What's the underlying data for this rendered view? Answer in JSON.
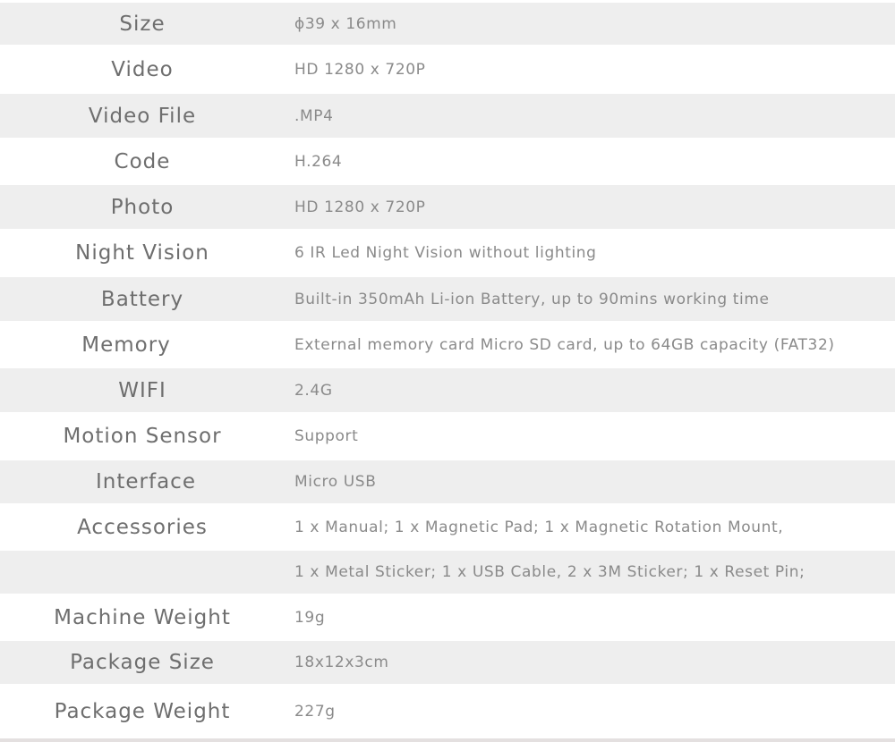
{
  "specs": [
    {
      "label": "Size",
      "value": "ϕ39 x 16mm"
    },
    {
      "label": "Video",
      "value": "HD 1280 x 720P"
    },
    {
      "label": "Video File",
      "value": ".MP4"
    },
    {
      "label": "Code",
      "value": "H.264"
    },
    {
      "label": "Photo",
      "value": "HD 1280 x 720P"
    },
    {
      "label": "Night Vision",
      "value": "6 IR Led Night Vision without lighting"
    },
    {
      "label": "Battery",
      "value": "Built-in 350mAh Li-ion Battery, up to 90mins working time"
    },
    {
      "label": "Memory",
      "value": "External memory card Micro SD card, up to 64GB capacity (FAT32)"
    },
    {
      "label": "WIFI",
      "value": "2.4G"
    },
    {
      "label": "Motion Sensor",
      "value": "Support"
    },
    {
      "label": "Interface",
      "value": "Micro USB"
    },
    {
      "label": "Accessories",
      "value": "1 x Manual; 1 x Magnetic Pad; 1 x Magnetic Rotation Mount,"
    },
    {
      "label": "",
      "value": "1 x Metal Sticker; 1 x USB Cable, 2 x 3M Sticker; 1 x Reset Pin;"
    },
    {
      "label": "Machine Weight",
      "value": "19g"
    },
    {
      "label": "Package Size",
      "value": "18x12x3cm"
    },
    {
      "label": "Package Weight",
      "value": "227g"
    }
  ]
}
